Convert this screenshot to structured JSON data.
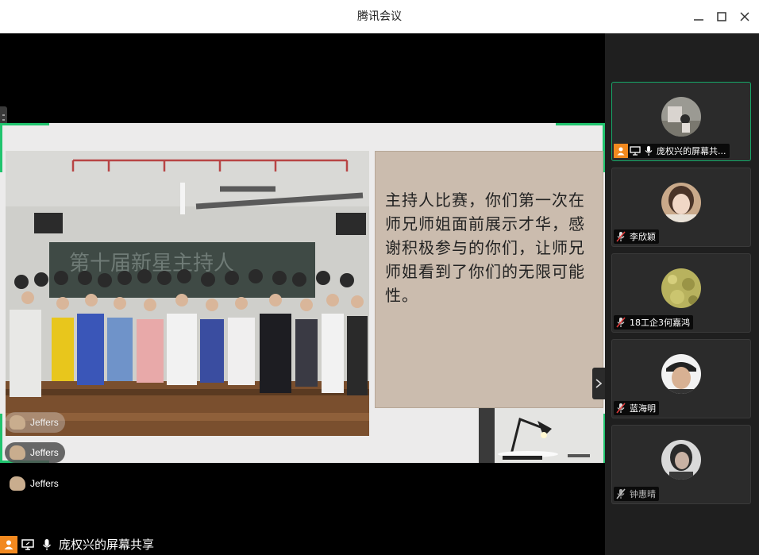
{
  "window": {
    "title": "腾讯会议"
  },
  "slide": {
    "text": "主持人比赛，你们第一次在师兄师姐面前展示才华，感谢积极参与的你们，让师兄师姐看到了你们的无限可能性。"
  },
  "reactions": [
    {
      "name": "Jeffers"
    },
    {
      "name": "Jeffers"
    },
    {
      "name": "Jeffers"
    }
  ],
  "share_bar": {
    "label": "庞权兴的屏幕共享"
  },
  "participants": [
    {
      "name": "庞权兴的屏幕共...",
      "icons": [
        "person-icon",
        "screen-share-icon",
        "mic-on-icon"
      ],
      "active": true
    },
    {
      "name": "李欣颖",
      "icons": [
        "mic-muted-icon"
      ],
      "active": false
    },
    {
      "name": "18工企3何嘉鸿",
      "icons": [
        "mic-muted-icon"
      ],
      "active": false
    },
    {
      "name": "蓝海明",
      "icons": [
        "mic-muted-icon"
      ],
      "active": false
    },
    {
      "name": "钟惠晴",
      "icons": [
        "mic-muted-icon"
      ],
      "active": false
    }
  ],
  "colors": {
    "accent": "#16a868",
    "share_orange": "#f2891f",
    "mute_red": "#e03b3b"
  }
}
